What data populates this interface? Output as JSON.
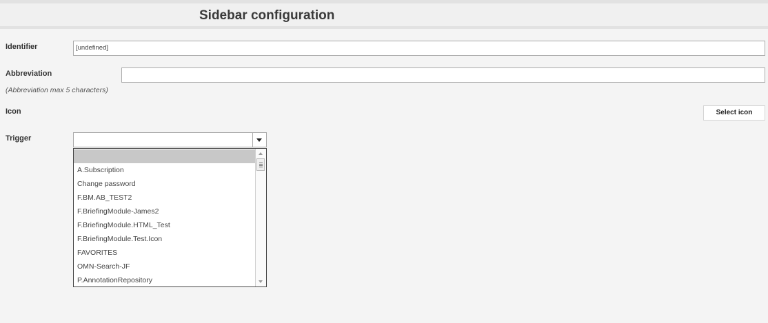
{
  "header": {
    "title": "Sidebar configuration"
  },
  "form": {
    "identifier": {
      "label": "Identifier",
      "value": "[undefined]"
    },
    "abbreviation": {
      "label": "Abbreviation",
      "value": "",
      "hint": "(Abbreviation max 5 characters)"
    },
    "icon": {
      "label": "Icon",
      "button_label": "Select icon"
    },
    "trigger": {
      "label": "Trigger",
      "selected_value": "",
      "options": [
        "",
        "A.Subscription",
        "Change password",
        "F.BM.AB_TEST2",
        "F.BriefingModule-James2",
        "F.BriefingModule.HTML_Test",
        "F.BriefingModule.Test.Icon",
        "FAVORITES",
        "OMN-Search-JF",
        "P.AnnotationRepository"
      ]
    }
  }
}
